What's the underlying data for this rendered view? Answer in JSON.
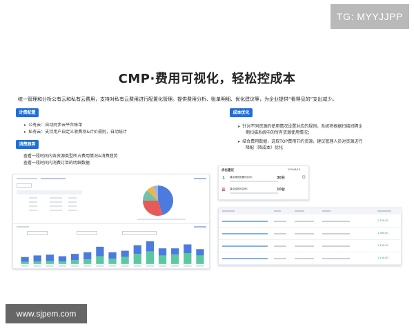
{
  "badge": "TG: MYYJJPP",
  "title": "CMP·费用可视化，轻松控成本",
  "intro": "统一管理和分析公有云和私有云费用，支持对私有云费用进行配置化管理。提供费用分析、账单明细、优化建议等，为企业提供“看得见的”支出减少。",
  "cost_config": {
    "tag": "计费配置",
    "items": [
      "公有云：自动同步云平台账单",
      "私有云：支持用户自定义收费项&计价规则，自动统计"
    ]
  },
  "consume_trend": {
    "tag": "消费趋势",
    "lines": [
      "查看一段时间内各资源类型所占费用情况&消费趋势",
      "查看一段时间内消费订单的明细数据"
    ]
  },
  "cost_optimize": {
    "tag": "成本优化",
    "items": [
      [
        "针对不同资源的使用情况设置对应的规则，系统将根据扫描间隔企",
        "期扫描系统中的所有资源使用情况；"
      ],
      [
        "结合费用数据，选取TOP费用节约资源，建议管理人员对资源进行",
        "降配（降成本）优化"
      ]
    ]
  },
  "opt_card": {
    "title": "优化建议",
    "date": "2020/8/18",
    "rows": [
      {
        "label": "建议降低配置的实例：",
        "count": "30台"
      },
      {
        "label": "建议释放的实例：",
        "count": "10台"
      }
    ],
    "colors": {
      "green": "#2f9e44",
      "red": "#c92a2a"
    }
  },
  "dashboard_left": {
    "chart_data": {
      "type": "bar",
      "series": [
        {
          "values": [
            18,
            22,
            24,
            20,
            26,
            30,
            44,
            30,
            34,
            48,
            58,
            40,
            40,
            50,
            38
          ]
        },
        {
          "values": [
            6,
            7,
            8,
            7,
            10,
            12,
            20,
            14,
            18,
            26,
            32,
            22,
            24,
            28,
            22
          ]
        }
      ],
      "ylim": [
        0,
        70
      ],
      "pie": {
        "values": [
          45,
          30,
          12,
          8,
          5
        ],
        "colors": [
          "#4c7be0",
          "#e85a5a",
          "#6fc3a8",
          "#f2b34c",
          "#9bb7e8"
        ]
      },
      "colors": {
        "series1": "#4c7be0",
        "series2": "#5cc8a0"
      }
    }
  },
  "dashboard_right": {
    "row_values": [
      "2,700.00",
      "1,980.00",
      "1,450.00",
      "1,100.00"
    ],
    "link_color": "#1e6fd9",
    "ok_color": "#2f9e44"
  },
  "watermark": "www.sjpem.com"
}
